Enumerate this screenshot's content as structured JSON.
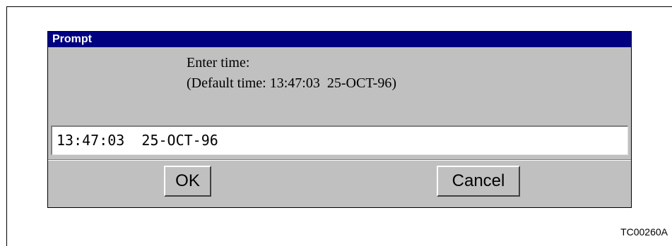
{
  "dialog": {
    "title": "Prompt",
    "message_line1": "Enter time:",
    "message_line2": "(Default time: 13:47:03  25-OCT-96)",
    "input_value": "13:47:03  25-OCT-96",
    "ok_label": "OK",
    "cancel_label": "Cancel"
  },
  "figure": {
    "id": "TC00260A"
  },
  "colors": {
    "title_bar": "#000080",
    "dialog_background": "#c0c0c0",
    "input_background": "#ffffff"
  }
}
